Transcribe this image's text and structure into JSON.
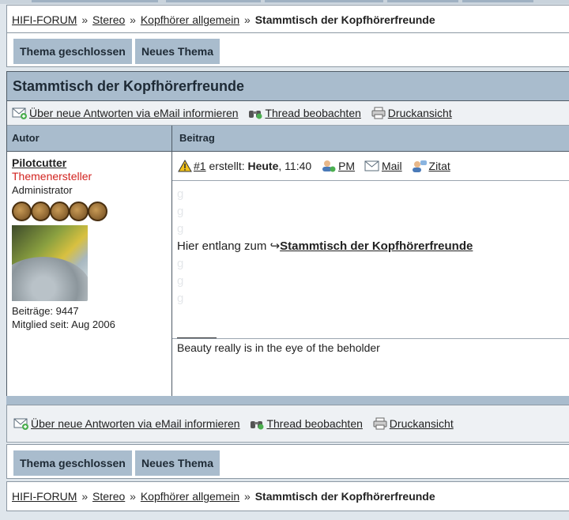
{
  "breadcrumb": {
    "items": [
      "HIFI-FORUM",
      "Stereo",
      "Kopfhörer allgemein"
    ],
    "current": "Stammtisch der Kopfhörerfreunde",
    "separator": "»"
  },
  "buttons": {
    "closed": "Thema geschlossen",
    "new_topic": "Neues Thema"
  },
  "thread": {
    "title": "Stammtisch der Kopfhörerfreunde",
    "tools": {
      "notify": "Über neue Antworten via eMail informieren",
      "watch": "Thread beobachten",
      "print": "Druckansicht"
    },
    "columns": {
      "author": "Autor",
      "post": "Beitrag"
    }
  },
  "post": {
    "number": "#1",
    "created_label": "erstellt:",
    "created_day": "Heute",
    "created_time": ", 11:40",
    "pm": "PM",
    "mail": "Mail",
    "quote": "Zitat",
    "filler": "g",
    "text_before": "Hier entlang zum ",
    "arrow": "↪",
    "link_text": "Stammtisch der Kopfhörerfreunde",
    "signature": "Beauty really is in the eye of the beholder"
  },
  "author": {
    "name": "Pilotcutter",
    "role": "Themenersteller",
    "rank": "Administrator",
    "stars": 5,
    "posts": "Beiträge: 9447",
    "member_since": "Mitglied seit: Aug 2006"
  },
  "colors": {
    "header_bg": "#a9bccd",
    "role": "#d2231f",
    "page_bg": "#dfe6ec"
  }
}
